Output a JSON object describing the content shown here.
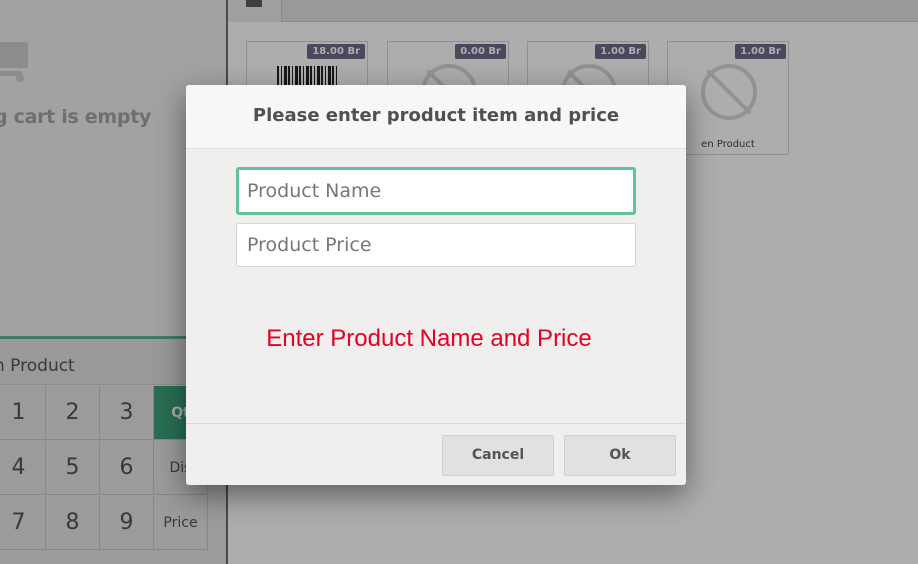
{
  "cart": {
    "empty_text": "g cart is empty",
    "product_row_label": "n Product"
  },
  "numpad": {
    "keys": [
      "1",
      "2",
      "3",
      "Qt",
      "4",
      "5",
      "6",
      "Dis",
      "7",
      "8",
      "9",
      "Price"
    ],
    "active_mode": "Qt"
  },
  "products": [
    {
      "price": "18.00 Br",
      "name": "",
      "image": "barcode"
    },
    {
      "price": "0.00 Br",
      "name": "",
      "image": "no-photo"
    },
    {
      "price": "1.00 Br",
      "name": "",
      "image": "no-photo"
    },
    {
      "price": "1.00 Br",
      "name": "en Product",
      "image": "no-photo"
    }
  ],
  "modal": {
    "title": "Please enter product item and price",
    "product_name_placeholder": "Product Name",
    "product_name_value": "",
    "product_price_placeholder": "Product Price",
    "product_price_value": "",
    "message": "Enter Product Name and Price",
    "cancel_label": "Cancel",
    "ok_label": "Ok"
  },
  "colors": {
    "accent": "#3ca37b",
    "focus_border": "#5fc49c",
    "error_text": "#e60023",
    "price_tag": "#6e6a8a"
  }
}
